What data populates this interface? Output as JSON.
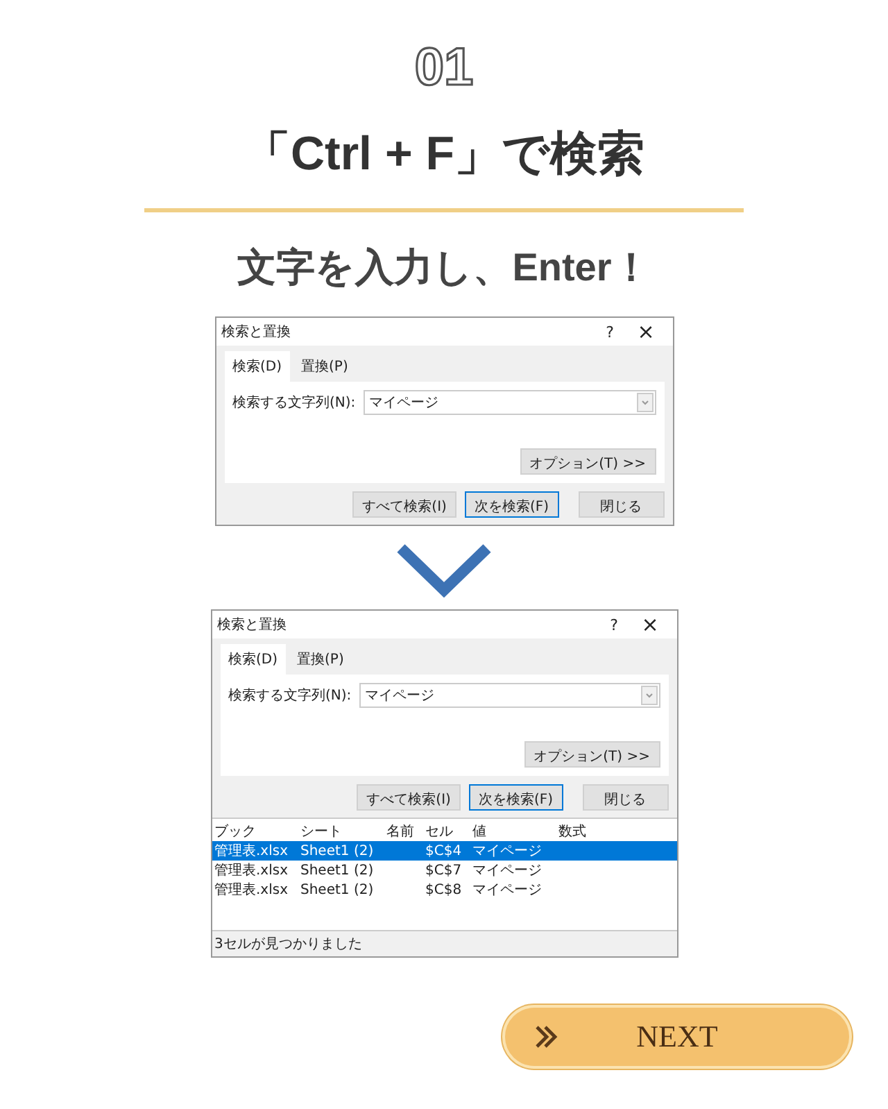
{
  "step": "01",
  "title": "「Ctrl + F」で検索",
  "subtitle": "文字を入力し、Enter！",
  "dialogs": [
    {
      "title": "検索と置換",
      "help": "?",
      "close": "×",
      "tabs": [
        {
          "label": "検索(D)",
          "selected": true
        },
        {
          "label": "置換(P)",
          "selected": false
        }
      ],
      "find_label": "検索する文字列(N):",
      "find_value": "マイページ",
      "options_button": "オプション(T) >>",
      "buttons": [
        {
          "label": "すべて検索(I)",
          "default": false
        },
        {
          "label": "次を検索(F)",
          "default": true
        },
        {
          "label": "閉じる",
          "default": false
        }
      ]
    },
    {
      "title": "検索と置換",
      "help": "?",
      "close": "×",
      "tabs": [
        {
          "label": "検索(D)",
          "selected": true
        },
        {
          "label": "置換(P)",
          "selected": false
        }
      ],
      "find_label": "検索する文字列(N):",
      "find_value": "マイページ",
      "options_button": "オプション(T) >>",
      "buttons": [
        {
          "label": "すべて検索(I)",
          "default": false
        },
        {
          "label": "次を検索(F)",
          "default": true
        },
        {
          "label": "閉じる",
          "default": false
        }
      ],
      "results": {
        "columns": [
          "ブック",
          "シート",
          "名前",
          "セル",
          "値",
          "数式"
        ],
        "rows": [
          {
            "cells": [
              "管理表.xlsx",
              "Sheet1 (2)",
              "",
              "$C$4",
              "マイページ",
              ""
            ],
            "selected": true
          },
          {
            "cells": [
              "管理表.xlsx",
              "Sheet1 (2)",
              "",
              "$C$7",
              "マイページ",
              ""
            ],
            "selected": false
          },
          {
            "cells": [
              "管理表.xlsx",
              "Sheet1 (2)",
              "",
              "$C$8",
              "マイページ",
              ""
            ],
            "selected": false
          }
        ]
      },
      "status": "3セルが見つかりました"
    }
  ],
  "next_button": "NEXT"
}
